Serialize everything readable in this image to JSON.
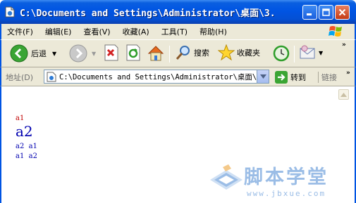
{
  "window": {
    "title": "C:\\Documents and Settings\\Administrator\\桌面\\3."
  },
  "menu": {
    "items": [
      "文件(F)",
      "编辑(E)",
      "查看(V)",
      "收藏(A)",
      "工具(T)",
      "帮助(H)"
    ]
  },
  "toolbar": {
    "back_label": "后退",
    "search_label": "搜索",
    "favorites_label": "收藏夹"
  },
  "address": {
    "label": "地址(D)",
    "value": "C:\\Documents and Settings\\Administrator\\桌面\\3.",
    "go_label": "转到",
    "links_label": "链接"
  },
  "content": {
    "line1": "a1",
    "line2": "a2",
    "line3": "a2  a1",
    "line4": "a1  a2"
  },
  "watermark": {
    "title": "脚本学堂",
    "subtitle": "www.jbxue.com"
  },
  "colors": {
    "titlebar": "#0054e3",
    "chrome": "#ece9d8",
    "content_text": "#0000b0",
    "content_red": "#c00000",
    "watermark": "#9bbde6"
  }
}
